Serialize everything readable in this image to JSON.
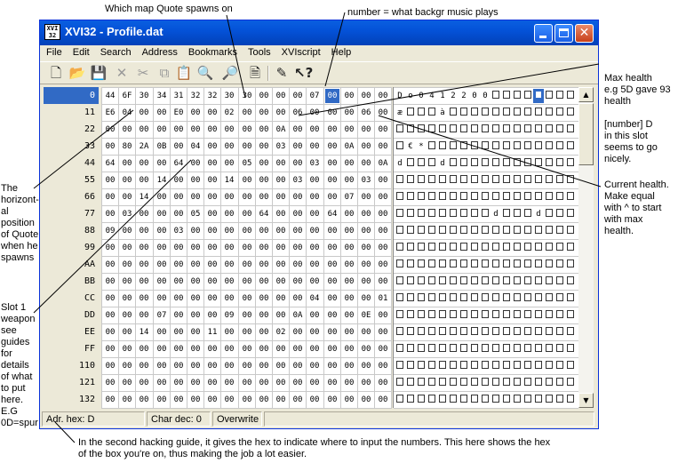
{
  "window": {
    "title": "XVI32 - Profile.dat",
    "icon_text": "XVI 32",
    "menu": [
      "File",
      "Edit",
      "Search",
      "Address",
      "Bookmarks",
      "Tools",
      "XVIscript",
      "Help"
    ],
    "toolbar_icons": [
      "new-icon",
      "open-icon",
      "save-icon",
      "delete-icon",
      "cut-icon",
      "copy-icon",
      "paste-icon",
      "find-icon",
      "replace-icon",
      "properties-icon",
      "script-icon",
      "help-icon"
    ]
  },
  "addresses": [
    "0",
    "11",
    "22",
    "33",
    "44",
    "55",
    "66",
    "77",
    "88",
    "99",
    "AA",
    "BB",
    "CC",
    "DD",
    "EE",
    "FF",
    "110",
    "121",
    "132"
  ],
  "hex_rows": [
    [
      "44",
      "6F",
      "30",
      "34",
      "31",
      "32",
      "32",
      "30",
      "30",
      "00",
      "00",
      "00",
      "07",
      "00",
      "00",
      "00",
      "00"
    ],
    [
      "E6",
      "04",
      "00",
      "00",
      "E0",
      "00",
      "00",
      "02",
      "00",
      "00",
      "00",
      "06",
      "00",
      "00",
      "00",
      "06",
      "00"
    ],
    [
      "00",
      "00",
      "00",
      "00",
      "00",
      "00",
      "00",
      "00",
      "00",
      "00",
      "0A",
      "00",
      "00",
      "00",
      "00",
      "00",
      "00"
    ],
    [
      "00",
      "80",
      "2A",
      "0B",
      "00",
      "04",
      "00",
      "00",
      "00",
      "00",
      "03",
      "00",
      "00",
      "00",
      "0A",
      "00",
      "00"
    ],
    [
      "64",
      "00",
      "00",
      "00",
      "64",
      "00",
      "00",
      "00",
      "05",
      "00",
      "00",
      "00",
      "03",
      "00",
      "00",
      "00",
      "0A"
    ],
    [
      "00",
      "00",
      "00",
      "14",
      "00",
      "00",
      "00",
      "14",
      "00",
      "00",
      "00",
      "03",
      "00",
      "00",
      "00",
      "03",
      "00"
    ],
    [
      "00",
      "00",
      "14",
      "00",
      "00",
      "00",
      "00",
      "00",
      "00",
      "00",
      "00",
      "00",
      "00",
      "00",
      "07",
      "00",
      "00"
    ],
    [
      "00",
      "03",
      "00",
      "00",
      "00",
      "05",
      "00",
      "00",
      "00",
      "64",
      "00",
      "00",
      "00",
      "64",
      "00",
      "00",
      "00"
    ],
    [
      "09",
      "00",
      "00",
      "00",
      "03",
      "00",
      "00",
      "00",
      "00",
      "00",
      "00",
      "00",
      "00",
      "00",
      "00",
      "00",
      "00"
    ],
    [
      "00",
      "00",
      "00",
      "00",
      "00",
      "00",
      "00",
      "00",
      "00",
      "00",
      "00",
      "00",
      "00",
      "00",
      "00",
      "00",
      "00"
    ],
    [
      "00",
      "00",
      "00",
      "00",
      "00",
      "00",
      "00",
      "00",
      "00",
      "00",
      "00",
      "00",
      "00",
      "00",
      "00",
      "00",
      "00"
    ],
    [
      "00",
      "00",
      "00",
      "00",
      "00",
      "00",
      "00",
      "00",
      "00",
      "00",
      "00",
      "00",
      "00",
      "00",
      "00",
      "00",
      "00"
    ],
    [
      "00",
      "00",
      "00",
      "00",
      "00",
      "00",
      "00",
      "00",
      "00",
      "00",
      "00",
      "00",
      "04",
      "00",
      "00",
      "00",
      "01"
    ],
    [
      "00",
      "00",
      "00",
      "07",
      "00",
      "00",
      "00",
      "09",
      "00",
      "00",
      "00",
      "0A",
      "00",
      "00",
      "00",
      "0E",
      "00"
    ],
    [
      "00",
      "00",
      "14",
      "00",
      "00",
      "00",
      "11",
      "00",
      "00",
      "00",
      "02",
      "00",
      "00",
      "00",
      "00",
      "00",
      "00"
    ],
    [
      "00",
      "00",
      "00",
      "00",
      "00",
      "00",
      "00",
      "00",
      "00",
      "00",
      "00",
      "00",
      "00",
      "00",
      "00",
      "00",
      "00"
    ],
    [
      "00",
      "00",
      "00",
      "00",
      "00",
      "00",
      "00",
      "00",
      "00",
      "00",
      "00",
      "00",
      "00",
      "00",
      "00",
      "00",
      "00"
    ],
    [
      "00",
      "00",
      "00",
      "00",
      "00",
      "00",
      "00",
      "00",
      "00",
      "00",
      "00",
      "00",
      "00",
      "00",
      "00",
      "00",
      "00"
    ],
    [
      "00",
      "00",
      "00",
      "00",
      "00",
      "00",
      "00",
      "00",
      "00",
      "00",
      "00",
      "00",
      "00",
      "00",
      "00",
      "00",
      "00"
    ]
  ],
  "text_rows": [
    [
      "D",
      "o",
      "0",
      "4",
      "1",
      "2",
      "2",
      "0",
      "0",
      "",
      "",
      "",
      "",
      "",
      "",
      "",
      ""
    ],
    [
      "æ",
      "",
      "",
      "",
      "à",
      "",
      "",
      "",
      "",
      "",
      "",
      "",
      "",
      "",
      "",
      "",
      ""
    ],
    [
      "",
      "",
      "",
      "",
      "",
      "",
      "",
      "",
      "",
      "",
      "",
      "",
      "",
      "",
      "",
      "",
      ""
    ],
    [
      "",
      "€",
      "*",
      "",
      "",
      "",
      "",
      "",
      "",
      "",
      "",
      "",
      "",
      "",
      "",
      "",
      ""
    ],
    [
      "d",
      "",
      "",
      "",
      "d",
      "",
      "",
      "",
      "",
      "",
      "",
      "",
      "",
      "",
      "",
      "",
      ""
    ],
    [
      "",
      "",
      "",
      "",
      "",
      "",
      "",
      "",
      "",
      "",
      "",
      "",
      "",
      "",
      "",
      "",
      ""
    ],
    [
      "",
      "",
      "",
      "",
      "",
      "",
      "",
      "",
      "",
      "",
      "",
      "",
      "",
      "",
      "",
      "",
      ""
    ],
    [
      "",
      "",
      "",
      "",
      "",
      "",
      "",
      "",
      "",
      "d",
      "",
      "",
      "",
      "d",
      "",
      "",
      ""
    ],
    [
      "",
      "",
      "",
      "",
      "",
      "",
      "",
      "",
      "",
      "",
      "",
      "",
      "",
      "",
      "",
      "",
      ""
    ],
    [
      "",
      "",
      "",
      "",
      "",
      "",
      "",
      "",
      "",
      "",
      "",
      "",
      "",
      "",
      "",
      "",
      ""
    ],
    [
      "",
      "",
      "",
      "",
      "",
      "",
      "",
      "",
      "",
      "",
      "",
      "",
      "",
      "",
      "",
      "",
      ""
    ],
    [
      "",
      "",
      "",
      "",
      "",
      "",
      "",
      "",
      "",
      "",
      "",
      "",
      "",
      "",
      "",
      "",
      ""
    ],
    [
      "",
      "",
      "",
      "",
      "",
      "",
      "",
      "",
      "",
      "",
      "",
      "",
      "",
      "",
      "",
      "",
      ""
    ],
    [
      "",
      "",
      "",
      "",
      "",
      "",
      "",
      "",
      "",
      "",
      "",
      "",
      "",
      "",
      "",
      "",
      ""
    ],
    [
      "",
      "",
      "",
      "",
      "",
      "",
      "",
      "",
      "",
      "",
      "",
      "",
      "",
      "",
      "",
      "",
      ""
    ],
    [
      "",
      "",
      "",
      "",
      "",
      "",
      "",
      "",
      "",
      "",
      "",
      "",
      "",
      "",
      "",
      "",
      ""
    ],
    [
      "",
      "",
      "",
      "",
      "",
      "",
      "",
      "",
      "",
      "",
      "",
      "",
      "",
      "",
      "",
      "",
      ""
    ],
    [
      "",
      "",
      "",
      "",
      "",
      "",
      "",
      "",
      "",
      "",
      "",
      "",
      "",
      "",
      "",
      "",
      ""
    ],
    [
      "",
      "",
      "",
      "",
      "",
      "",
      "",
      "",
      "",
      "",
      "",
      "",
      "",
      "",
      "",
      "",
      ""
    ]
  ],
  "selection": {
    "row": 0,
    "col": 13
  },
  "status": {
    "address": "Adr. hex: D",
    "char": "Char dec: 0",
    "mode": "Overwrite"
  },
  "annotations": {
    "map": "Which map Quote spawns on",
    "music": "number = what backgr music plays",
    "max_health": "Max health\ne.g 5D gave 93\nhealth\n\n[number] D\nin this slot\nseems to go\nnicely.",
    "current_health": "Current health.\nMake equal\nwith ^ to start\nwith max\nhealth.",
    "horizontal": "The\nhorizont-\nal\nposition\nof Quote\nwhen he\nspawns",
    "weapon": "Slot 1\nweapon\nsee\nguides\nfor\ndetails\nof what\nto put\nhere.\nE.G\n0D=spur",
    "bottom": "In the second hacking guide, it gives the hex to indicate where to input the numbers. This here shows the hex\nof the box you're on, thus making the job a lot easier."
  },
  "colors": {
    "selection": "#316ac5",
    "titlebar": "#0452d8",
    "chrome": "#ece9d8"
  }
}
